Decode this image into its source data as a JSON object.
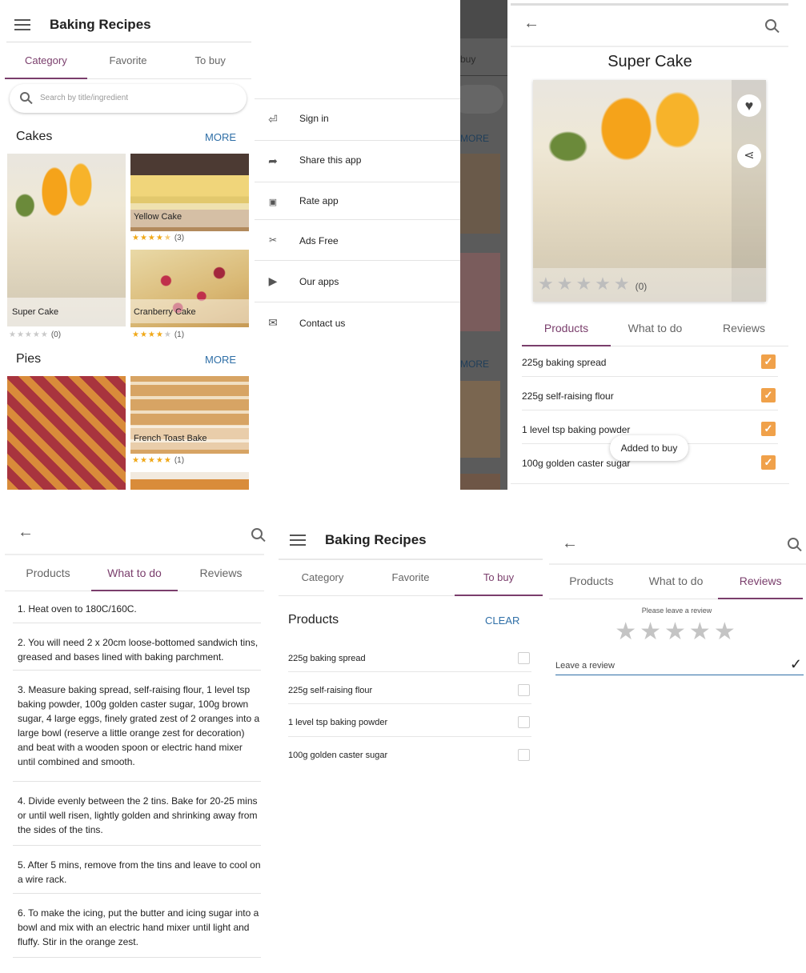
{
  "p1": {
    "app_title": "Baking Recipes",
    "tabs": [
      "Category",
      "Favorite",
      "To buy"
    ],
    "search_placeholder": "Search by title/ingredient",
    "cakes": {
      "heading": "Cakes",
      "more": "MORE",
      "items": [
        {
          "name": "Super Cake",
          "rating": 0,
          "count": "(0)"
        },
        {
          "name": "Yellow Cake",
          "rating": 4.5,
          "count": "(3)"
        },
        {
          "name": "Cranberry Cake",
          "rating": 4,
          "count": "(1)"
        }
      ]
    },
    "pies": {
      "heading": "Pies",
      "more": "MORE",
      "items": [
        {
          "name": "French Toast Bake",
          "rating": 5,
          "count": "(1)"
        }
      ]
    }
  },
  "p2": {
    "drawer": [
      {
        "icon": "sign-in-icon",
        "label": "Sign in"
      },
      {
        "icon": "share-icon",
        "label": "Share this app"
      },
      {
        "icon": "star-box-icon",
        "label": "Rate app"
      },
      {
        "icon": "ads-free-icon",
        "label": "Ads Free"
      },
      {
        "icon": "play-icon",
        "label": "Our apps"
      },
      {
        "icon": "mail-icon",
        "label": "Contact us"
      }
    ],
    "behind": {
      "tab": "buy",
      "more1": "MORE",
      "more2": "MORE"
    }
  },
  "p3": {
    "title": "Super Cake",
    "rating_count": "(0)",
    "tabs": [
      "Products",
      "What to do",
      "Reviews"
    ],
    "products": [
      "225g baking spread",
      "225g self-raising flour",
      "1 level tsp baking powder",
      "100g golden caster sugar"
    ],
    "toast": "Added to buy"
  },
  "p4": {
    "tabs": [
      "Products",
      "What to do",
      "Reviews"
    ],
    "steps": [
      "1. Heat oven to 180C/160C.",
      "2. You will need 2 x 20cm loose-bottomed sandwich tins, greased and bases lined with baking parchment.",
      "3. Measure baking spread, self-raising flour, 1 level tsp baking powder, 100g golden caster sugar, 100g brown sugar, 4 large eggs, finely grated zest of 2 oranges into a large bowl (reserve a little orange zest for decoration) and beat with a wooden spoon or electric hand mixer until combined and smooth.",
      "4. Divide evenly between the 2 tins. Bake for 20-25 mins or until well risen, lightly golden and shrinking away from the sides of the tins.",
      "5. After 5 mins, remove from the tins and leave to cool on a wire rack.",
      "6. To make the icing, put the butter and icing sugar into a bowl and mix with an electric hand mixer until light and fluffy. Stir in the orange zest."
    ]
  },
  "p5": {
    "app_title": "Baking Recipes",
    "tabs": [
      "Category",
      "Favorite",
      "To buy"
    ],
    "heading": "Products",
    "clear": "CLEAR",
    "items": [
      "225g baking spread",
      "225g self-raising flour",
      "1 level tsp baking powder",
      "100g golden caster sugar"
    ]
  },
  "p6": {
    "tabs": [
      "Products",
      "What to do",
      "Reviews"
    ],
    "prompt": "Please leave a review",
    "placeholder": "Leave a review"
  },
  "colors": {
    "accent": "#7a3e6c",
    "link": "#2f6fa7",
    "star": "#f0a818",
    "check": "#f0a14a"
  }
}
